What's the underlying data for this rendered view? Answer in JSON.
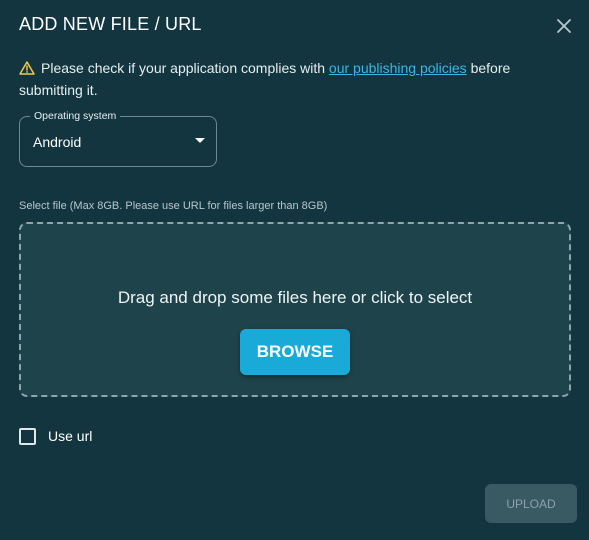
{
  "dialog": {
    "title": "ADD NEW FILE / URL",
    "close_icon": "close-icon"
  },
  "notice": {
    "icon": "warning-icon",
    "text_before": "Please check if your application complies with ",
    "link_text": "our publishing policies",
    "text_after": " before submitting it."
  },
  "os_select": {
    "label": "Operating system",
    "value": "Android",
    "icon": "dropdown-caret-icon"
  },
  "file": {
    "label": "Select file (Max 8GB. Please use URL for files larger than 8GB)",
    "dropzone_text": "Drag and drop some files here or click to select",
    "browse_label": "BROWSE"
  },
  "use_url": {
    "label": "Use url",
    "checked": false
  },
  "actions": {
    "upload_label": "UPLOAD",
    "upload_enabled": false
  },
  "colors": {
    "background": "#13353f",
    "dropzone_bg": "#1f434a",
    "accent": "#1aaad8",
    "link": "#3ab7e6",
    "warning": "#f2c94c",
    "disabled_button": "#3a5a63"
  }
}
